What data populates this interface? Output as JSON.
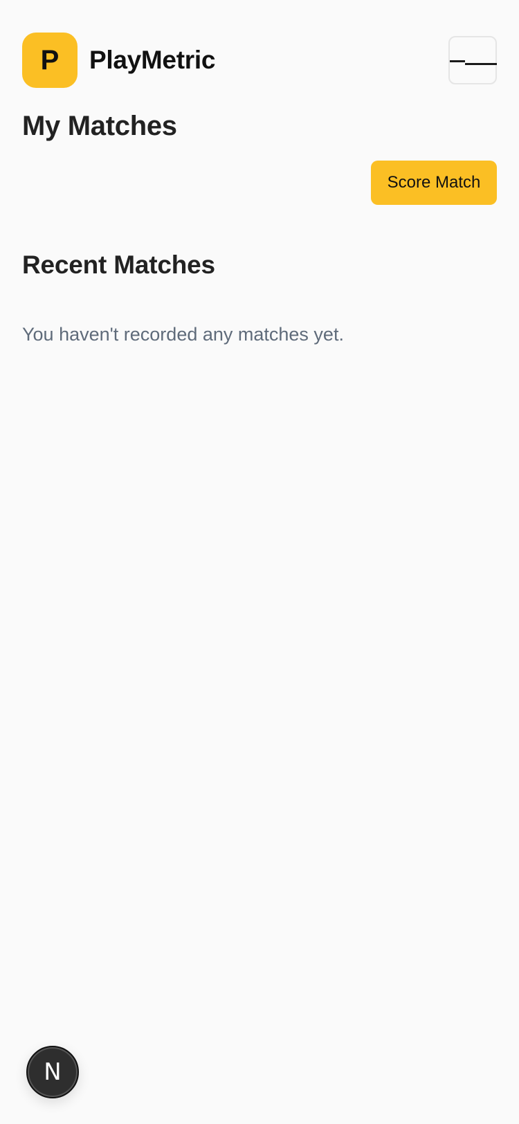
{
  "header": {
    "logo_letter": "P",
    "app_name": "PlayMetric",
    "menu_icon": "hamburger-menu-icon"
  },
  "main": {
    "page_title": "My Matches",
    "score_button_label": "Score Match",
    "recent_section_title": "Recent Matches",
    "empty_state_text": "You haven't recorded any matches yet."
  },
  "fab": {
    "letter": "N",
    "icon": "nextjs-logo-icon"
  },
  "colors": {
    "accent": "#FBBF24",
    "background": "#FAFAFA",
    "muted_text": "#5F6B7A"
  }
}
